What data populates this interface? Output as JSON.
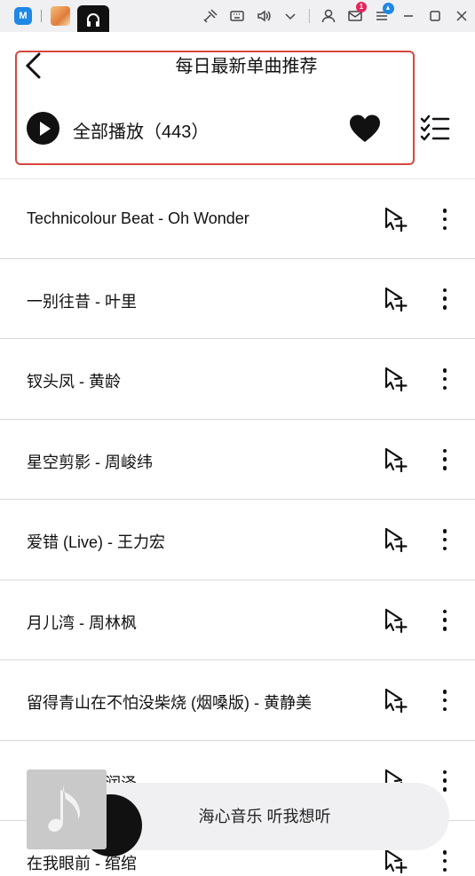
{
  "titlebar": {
    "app_logo_text": "M",
    "tabs": [
      "image-tab",
      "music-tab"
    ],
    "badges": {
      "mail": "1"
    },
    "icons": [
      "scissors-bird-icon",
      "keyboard-icon",
      "speaker-icon",
      "chevron-down-icon",
      "user-icon",
      "mail-icon",
      "menu-icon",
      "minimize-icon",
      "maximize-icon",
      "close-icon"
    ]
  },
  "header": {
    "title": "每日最新单曲推荐",
    "play_all_label": "全部播放（443）"
  },
  "songs": [
    {
      "title": "Technicolour Beat - Oh Wonder"
    },
    {
      "title": "一别往昔 - 叶里"
    },
    {
      "title": "钗头凤 - 黄龄"
    },
    {
      "title": "星空剪影 - 周峻纬"
    },
    {
      "title": "爱错 (Live) - 王力宏"
    },
    {
      "title": "月儿湾 - 周林枫"
    },
    {
      "title": "留得青山在不怕没柴烧 (烟嗓版) - 黄静美"
    },
    {
      "title": "…彩礼 - 卢润泽"
    },
    {
      "title": "在我眼前 - 绾绾"
    }
  ],
  "mini_player": {
    "text": "海心音乐 听我想听"
  },
  "colors": {
    "highlight": "#d9463e",
    "accent": "#1e88e5",
    "badge": "#e5245e"
  }
}
